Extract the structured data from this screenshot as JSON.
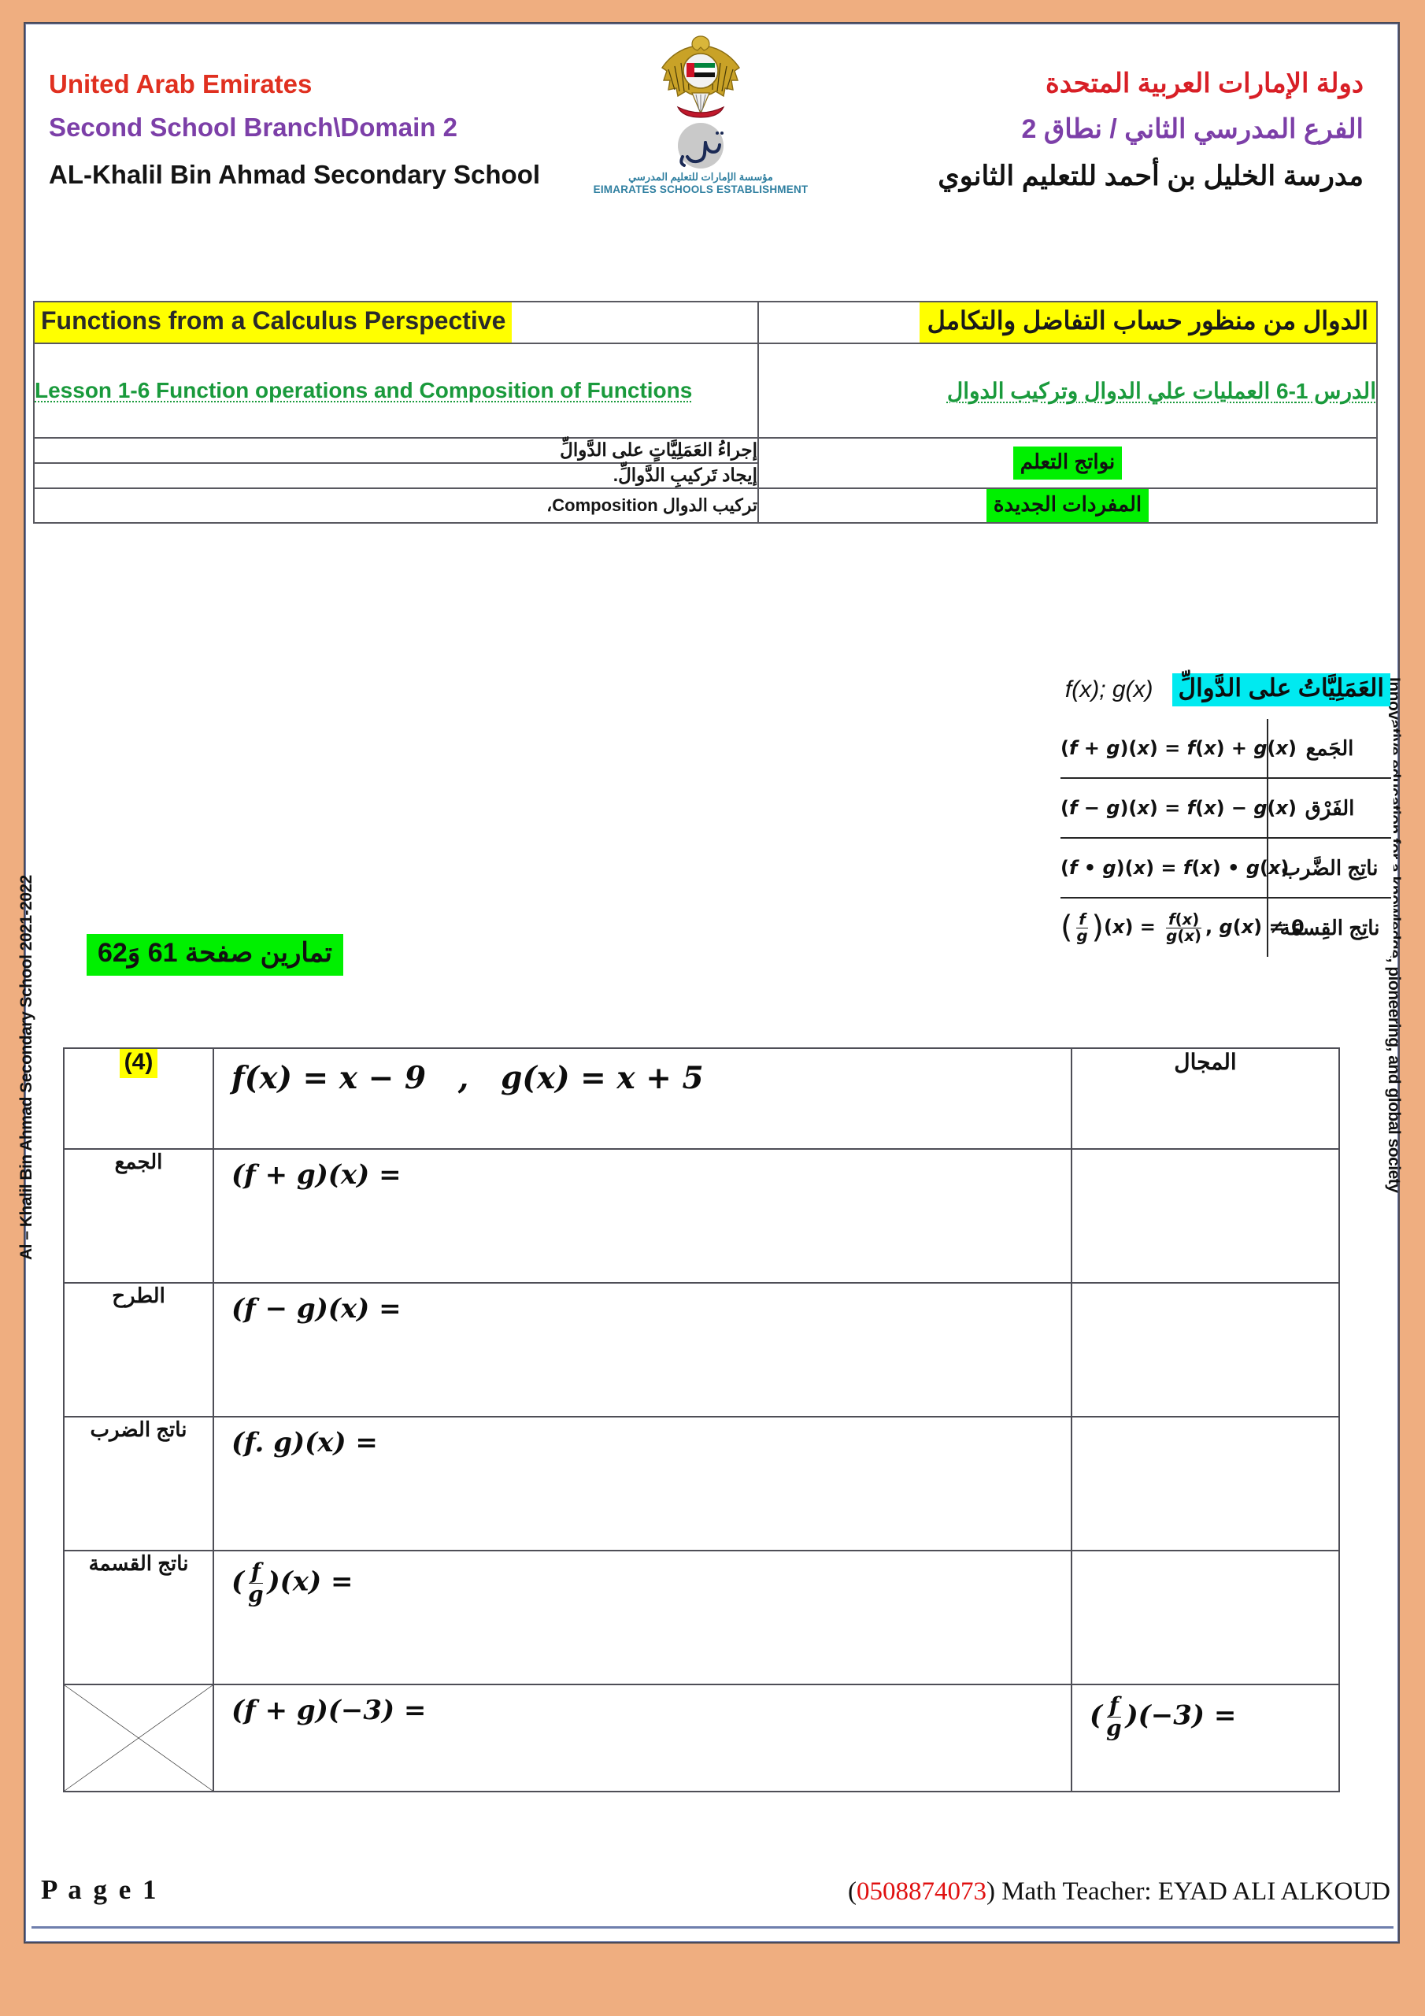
{
  "page": {
    "background_color": "#efae80",
    "sheet_color": "#ffffff",
    "border_color": "#4a4a58"
  },
  "margins": {
    "left_vertical_text": "Al – Khalil Bin Ahmad Secondary School 2021-2022",
    "right_vertical_text": "Innovative education for a knowledge, pioneering, and global society"
  },
  "header": {
    "english": {
      "country": "United Arab Emirates",
      "branch": "Second School Branch\\Domain 2",
      "school": "AL-Khalil Bin Ahmad Secondary School"
    },
    "arabic": {
      "country": "دولة الإمارات العربية المتحدة",
      "branch": "الفرع المدرسي الثاني / نطاق 2",
      "school": "مدرسة الخليل بن أحمد للتعليم الثانوي"
    },
    "logos": {
      "emblem_icon": "uae-falcon-emblem-icon",
      "ese_icon": "emirates-schools-establishment-icon",
      "ese_arabic_name": "مؤسسة الإمارات للتعليم المدرسي",
      "ese_english_name": "EIMARATES SCHOOLS ESTABLISHMENT"
    }
  },
  "info_table": {
    "unit_title_en": "Functions from a Calculus Perspective",
    "unit_title_ar": "الدوال من منظور حساب التفاضل والتكامل",
    "lesson_title_en": "Lesson 1-6 Function operations and Composition of Functions",
    "lesson_title_ar": "الدرس 1-6 العمليات علي الدوال وتركيب الدوال",
    "outcomes_label": "نواتج التعلم",
    "outcomes": [
      "إجراءُ العَمَلِيَّاتٍ على الدَّوالِّ",
      "إيجاد تَركيبِ الدَّوالِّ."
    ],
    "vocabulary_label": "المفردات الجديدة",
    "vocabulary": "تركيب الدوال Composition،",
    "highlight_colors": {
      "title": "#ffff00",
      "label": "#00f000"
    }
  },
  "operations_table": {
    "title_ar": "العَمَلِيَّاتُ على الدَّوالِّ",
    "title_highlight": "#00eaf0",
    "functions_label": "f(x); g(x)",
    "rows": [
      {
        "name": "الجَمع",
        "formula_html": "(<i>f</i> + <i>g</i>)(<i>x</i>) = <i>f</i>(<i>x</i>) + <i>g</i>(<i>x</i>)"
      },
      {
        "name": "الفَرْق",
        "formula_html": "(<i>f</i> − <i>g</i>)(<i>x</i>) = <i>f</i>(<i>x</i>) − <i>g</i>(<i>x</i>)"
      },
      {
        "name": "ناتِج الضَّرب",
        "formula_html": "(<i>f</i> • <i>g</i>)(<i>x</i>) = <i>f</i>(<i>x</i>) • <i>g</i>(<i>x</i>)"
      },
      {
        "name": "ناتِج القِسمَة",
        "formula_html": "<span class='paren-big'>(</span><span class='frac'><span class='num'><i>f</i></span><span class='den'><i>g</i></span></span><span class='paren-big'>)</span>(<i>x</i>) = <span class='frac'><span class='num'><i>f</i>(<i>x</i>)</span><span class='den'><i>g</i>(<i>x</i>)</span></span>, <i>g</i>(<i>x</i>) ≠ 0"
      }
    ]
  },
  "exercises_note": {
    "text": "تمارين صفحة 61 وَ62",
    "highlight": "#00f000"
  },
  "exercise_table": {
    "question_number": "(4)",
    "question_number_highlight": "#ffff00",
    "functions_given_html": "<i>f</i>(<i>x</i>) = <i>x</i> − 9&nbsp;&nbsp; ,&nbsp;&nbsp; <i>g</i>(<i>x</i>) = <i>x</i> + 5",
    "domain_header": "المجال",
    "rows": [
      {
        "label": "الجمع",
        "expr_html": "(<i>f</i> + <i>g</i>)(<i>x</i>) =",
        "answer": "",
        "domain": ""
      },
      {
        "label": "الطرح",
        "expr_html": "(<i>f</i> − <i>g</i>)(<i>x</i>) =",
        "answer": "",
        "domain": ""
      },
      {
        "label": "ناتج الضرب",
        "expr_html": "(<i>f</i>. <i>g</i>)(<i>x</i>) =",
        "answer": "",
        "domain": ""
      },
      {
        "label": "ناتج القسمة",
        "expr_html": "(<span class='frac'><span class='num'><i>f</i></span><span class='den'><i>g</i></span></span>)(<i>x</i>) =",
        "answer": "",
        "domain": ""
      }
    ],
    "evaluation_row": {
      "left_expr_html": "(<i>f</i> + <i>g</i>)(−3) =",
      "right_expr_html": "(<span class='frac'><span class='num'><i>f</i></span><span class='den'><i>g</i></span></span>)(−3) =",
      "left_answer": "",
      "right_answer": "",
      "crossed_out": true
    }
  },
  "footer": {
    "page_label": "P a g e 1",
    "phone": "0508874073",
    "teacher_text": ") Math Teacher: EYAD ALI ALKOUD",
    "open_paren": "(",
    "phone_color": "#e01010"
  }
}
